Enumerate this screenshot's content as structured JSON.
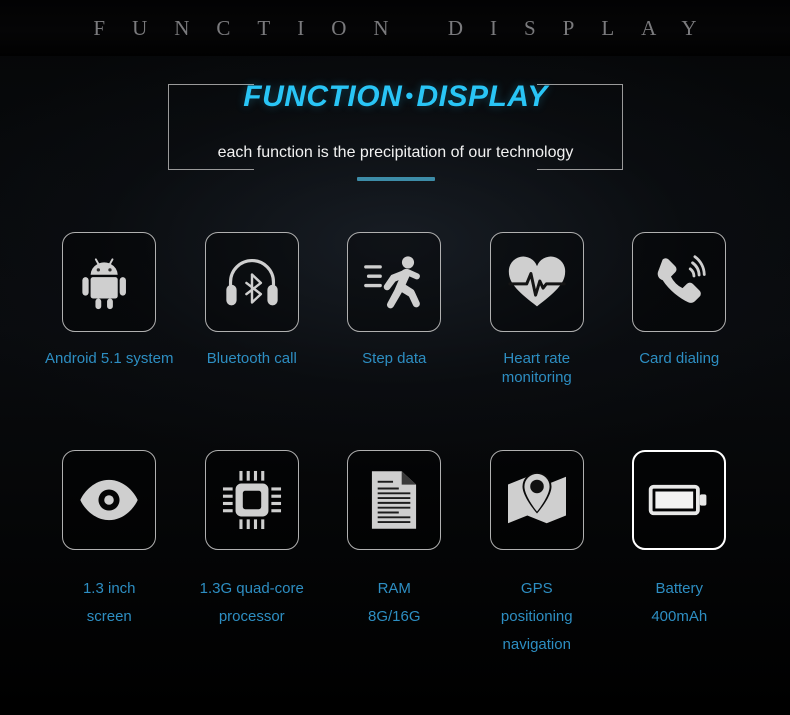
{
  "banner": {
    "text": "FUNCTION DISPLAY"
  },
  "title": {
    "left": "FUNCTION",
    "dot": "•",
    "right": "DISPLAY",
    "subtitle": "each function is the precipitation of our technology"
  },
  "colors": {
    "accent_cyan": "#29c5f6",
    "label_blue": "#2d8ec2",
    "underline": "#3d8ca8",
    "icon_gray": "#cfcfcf",
    "box_border": "#b0b0b0",
    "banner_text": "#8b8b8e",
    "background": "#000000"
  },
  "features": {
    "row1": [
      {
        "icon": "android-robot-icon",
        "label": "Android 5.1 system"
      },
      {
        "icon": "bluetooth-headphones-icon",
        "label": "Bluetooth call"
      },
      {
        "icon": "running-person-icon",
        "label": "Step data"
      },
      {
        "icon": "heart-pulse-icon",
        "label": "Heart rate\nmonitoring"
      },
      {
        "icon": "phone-handset-icon",
        "label": "Card dialing"
      }
    ],
    "row2": [
      {
        "icon": "eye-icon",
        "label": "1.3 inch\nscreen"
      },
      {
        "icon": "cpu-chip-icon",
        "label": "1.3G quad-core\nprocessor"
      },
      {
        "icon": "document-icon",
        "label": "RAM\n8G/16G"
      },
      {
        "icon": "map-pin-icon",
        "label": "GPS\npositioning navigation"
      },
      {
        "icon": "battery-icon",
        "label": "Battery\n400mAh"
      }
    ]
  }
}
